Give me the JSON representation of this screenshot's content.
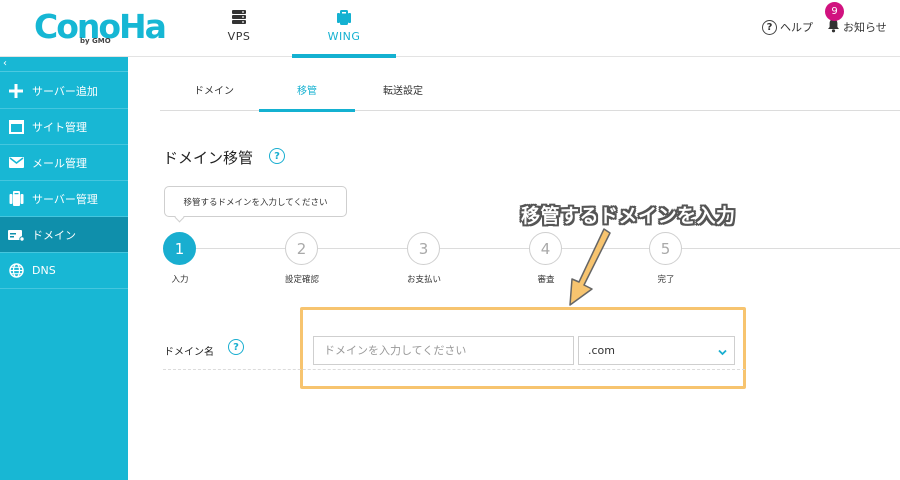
{
  "brand": {
    "logo_text": "ConoHa",
    "logo_sub": "by GMO"
  },
  "topnav": {
    "items": [
      {
        "label": "VPS",
        "icon": "server-stack-icon"
      },
      {
        "label": "WING",
        "icon": "wing-icon",
        "active": true
      }
    ],
    "help_label": "ヘルプ",
    "notice_label": "お知らせ",
    "notice_count": "9"
  },
  "sidebar": {
    "collapse_glyph": "‹",
    "items": [
      {
        "label": "サーバー追加",
        "icon": "plus-icon"
      },
      {
        "label": "サイト管理",
        "icon": "window-icon"
      },
      {
        "label": "メール管理",
        "icon": "mail-icon"
      },
      {
        "label": "サーバー管理",
        "icon": "server-icon"
      },
      {
        "label": "ドメイン",
        "icon": "domain-icon",
        "active": true
      },
      {
        "label": "DNS",
        "icon": "globe-icon"
      }
    ]
  },
  "tabs": [
    {
      "label": "ドメイン"
    },
    {
      "label": "移管",
      "active": true
    },
    {
      "label": "転送設定"
    }
  ],
  "page": {
    "title": "ドメイン移管",
    "tooltip": "移管するドメインを入力してください",
    "annotation": "移管するドメインを入力"
  },
  "steps": [
    {
      "num": "1",
      "label": "入力",
      "active": true
    },
    {
      "num": "2",
      "label": "設定確認"
    },
    {
      "num": "3",
      "label": "お支払い"
    },
    {
      "num": "4",
      "label": "審査"
    },
    {
      "num": "5",
      "label": "完了"
    }
  ],
  "form": {
    "label": "ドメイン名",
    "input_value": "",
    "input_placeholder": "ドメインを入力してください",
    "tld_selected": ".com"
  },
  "colors": {
    "accent": "#19aed0",
    "sidebar": "#18b7d4",
    "sidebar_active": "#0f8fab",
    "badge": "#d1127f",
    "highlight": "#f7c46f"
  }
}
